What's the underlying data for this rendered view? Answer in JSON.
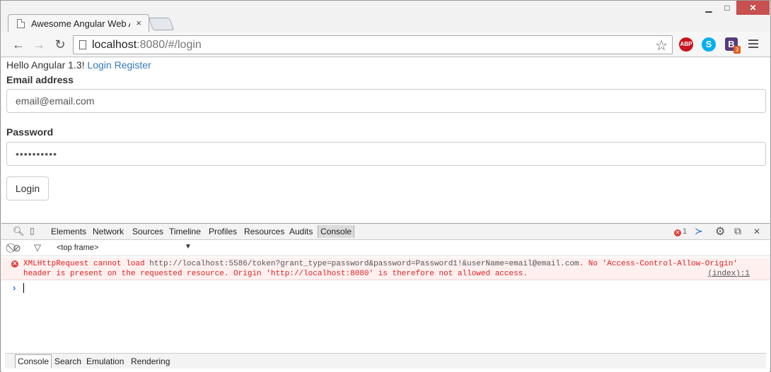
{
  "tab": {
    "title": "Awesome Angular Web A",
    "close": "×"
  },
  "window_controls": {
    "minimize": "▁",
    "maximize": "□",
    "close": "✕"
  },
  "toolbar": {
    "url_host": "localhost",
    "url_path": ":8080/#/login",
    "extensions": {
      "abp": "ABP",
      "skype": "S",
      "bootstrap": "B",
      "bootstrap_badge": "3"
    }
  },
  "page": {
    "hello": "Hello Angular 1.3!",
    "login_link": "Login",
    "register_link": "Register",
    "email_label": "Email address",
    "email_value": "email@email.com",
    "password_label": "Password",
    "password_value": "••••••••••",
    "login_button": "Login"
  },
  "devtools": {
    "tabs": [
      "Elements",
      "Network",
      "Sources",
      "Timeline",
      "Profiles",
      "Resources",
      "Audits",
      "Console"
    ],
    "active_tab": "Console",
    "error_count": "1",
    "frame_select": "<top frame>",
    "console_error": {
      "prefix": "XMLHttpRequest cannot load ",
      "url": "http://localhost:5586/token?grant_type=password&password=Password1!&userName=email@email.com",
      "suffix": ". No 'Access-Control-Allow-Origin'",
      "line2": "header is present on the requested resource. Origin 'http://localhost:8080' is therefore not allowed access.",
      "source": "(index):1"
    },
    "drawer_tabs": [
      "Console",
      "Search",
      "Emulation",
      "Rendering"
    ]
  }
}
